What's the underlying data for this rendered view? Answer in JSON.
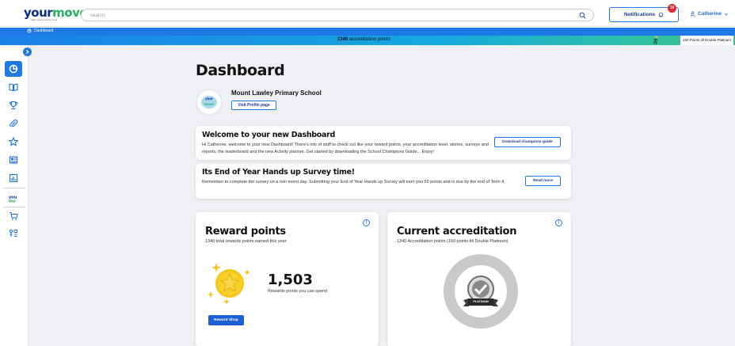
{
  "app": {
    "logo_text_a": "your",
    "logo_text_b": "move",
    "logo_tagline": "make every journey count"
  },
  "search": {
    "placeholder": "Search",
    "value": ""
  },
  "header": {
    "notifications_label": "Notifications",
    "notifications_count": "16",
    "user_name": "Catherine"
  },
  "breadcrumb": {
    "label": "Dashboard"
  },
  "accreditation_banner": {
    "points_value": "1340",
    "points_label": "accreditation points",
    "double_platinum_label": "160 Points till Double Platinum"
  },
  "sidebar": {
    "items": [
      {
        "name": "dashboard",
        "icon": "pie-chart-icon",
        "active": true
      },
      {
        "name": "stories",
        "icon": "book-open-icon"
      },
      {
        "name": "leaderboard",
        "icon": "trophy-icon"
      },
      {
        "name": "resources",
        "icon": "paperclip-icon"
      },
      {
        "name": "favourites",
        "icon": "star-icon"
      },
      {
        "name": "surveys",
        "icon": "survey-icon"
      },
      {
        "name": "reports",
        "icon": "bar-chart-icon"
      },
      {
        "name": "your-move",
        "icon": "your-move-logo-icon"
      },
      {
        "name": "reward-shop",
        "icon": "cart-icon"
      },
      {
        "name": "activity-planner",
        "icon": "planner-icon"
      }
    ]
  },
  "main": {
    "title": "Dashboard",
    "school": {
      "name": "Mount Lawley Primary School",
      "profile_button": "Visit Profile page",
      "logo_text_a": "your",
      "logo_text_b": "move"
    },
    "welcome": {
      "title": "Welcome to your new Dashboard",
      "body": "Hi Catherine, welcome to your new Dashboard! There's lots of stuff to check out like your reward points, your accreditation level, stories, surveys and reports, the leaderboard and the new Activity planner. Get started by downloading the School Champions Guide... Enjoy!",
      "button": "Download champions guide"
    },
    "survey": {
      "title": "Its End of Year Hands up Survey time!",
      "body": "Remember to complete the survey on a non event day. Submitting your End of Year Hands up Survey will earn you 50 points and is due by the end of Term 4.",
      "button": "Read more"
    },
    "reward_points": {
      "title": "Reward points",
      "subtitle": "1340 total rewards points earned this year",
      "value": "1,503",
      "value_label": "Rewards points you can spend",
      "button": "Reward Shop",
      "info": "i"
    },
    "current_accreditation": {
      "title": "Current accreditation",
      "subtitle": "1340 Accreditation points (160 points till Double Platinum)",
      "level": "PLATINUM",
      "info": "i"
    }
  },
  "colors": {
    "primary_blue": "#1e78e6",
    "navy_text": "#1a3a9a",
    "brand_green": "#27ae60",
    "badge_red": "#e0282e",
    "gold": "#f5c518"
  }
}
